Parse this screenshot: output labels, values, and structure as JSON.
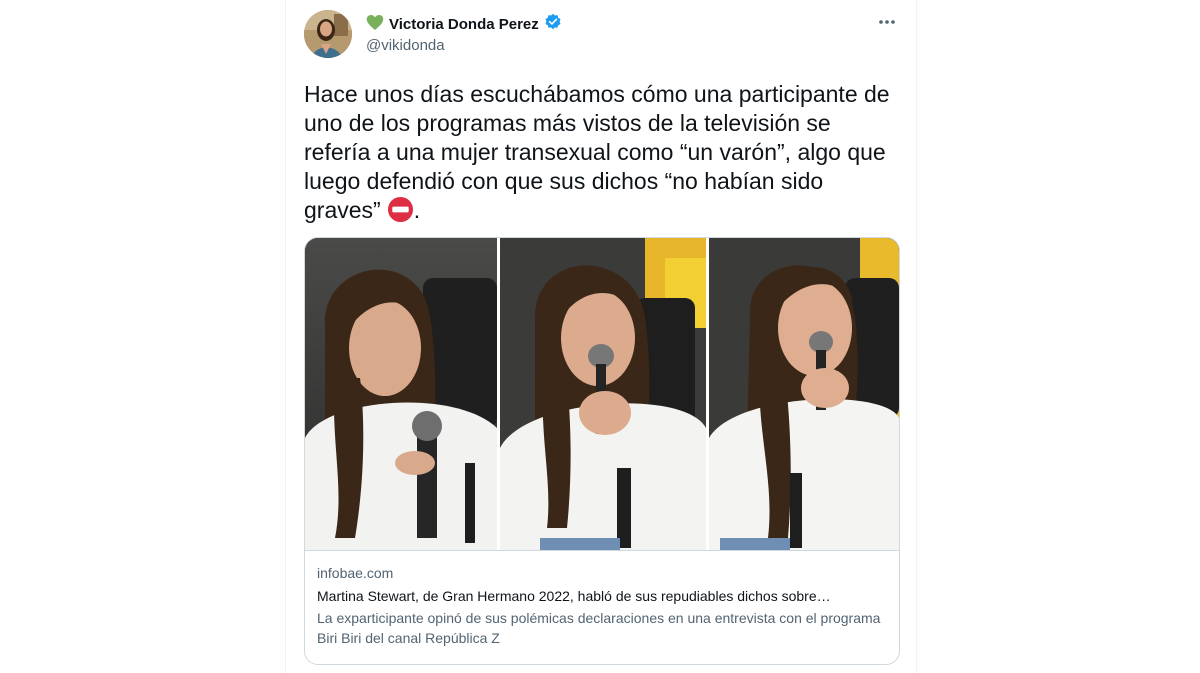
{
  "author": {
    "emoji": "green-heart",
    "name": "Victoria Donda Perez",
    "verified": true,
    "handle": "@vikidonda"
  },
  "more_icon": "more-horizontal-icon",
  "tweet": {
    "text": "Hace unos días escuchábamos cómo una participante de uno de los programas más vistos de la televisión se refería a una mujer transexual como “un varón”, algo que luego defendió con que sus dichos “no habían sido graves”",
    "trailing_emoji": "no-entry",
    "trailing_punct": "."
  },
  "link_card": {
    "domain": "infobae.com",
    "title": "Martina Stewart, de Gran Hermano 2022, habló de sus repudiables dichos sobre…",
    "description": "La exparticipante opinó de sus polémicas declaraciones en una entrevista con el programa Biri Biri del canal República Z"
  },
  "colors": {
    "text": "#0f1419",
    "secondary": "#536471",
    "border": "#cfd9de",
    "verified": "#1d9bf0",
    "heart": "#78b159",
    "no_entry": "#dd2e44"
  }
}
